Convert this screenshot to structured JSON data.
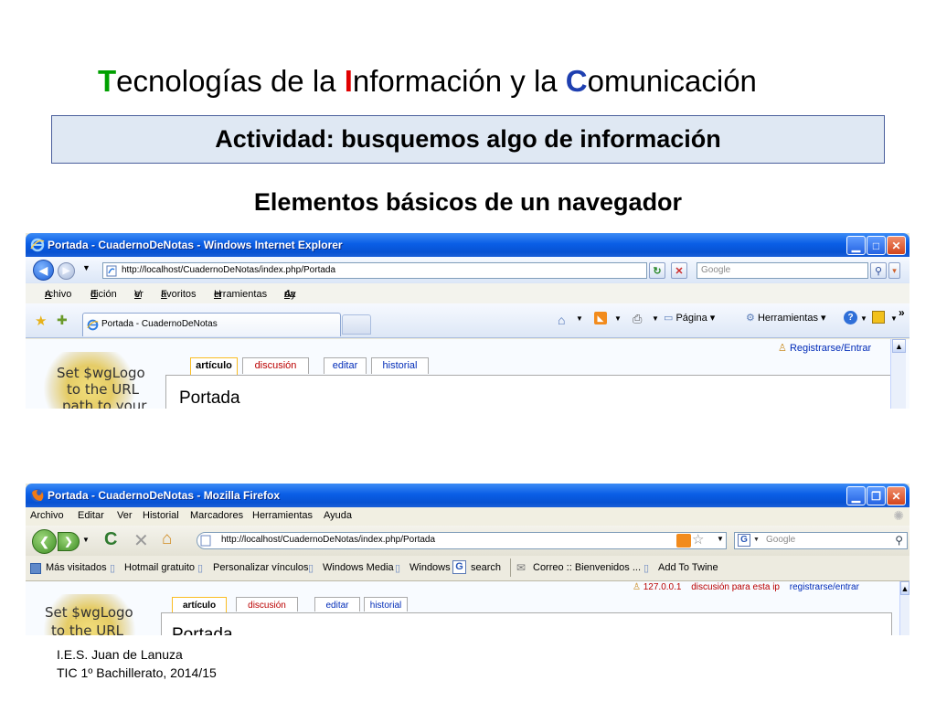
{
  "slide": {
    "title_parts": {
      "t_cap": "T",
      "t_rest": "ecnologías de la ",
      "i_cap": "I",
      "i_rest": "nformación y la ",
      "c_cap": "C",
      "c_rest": "omunicación"
    },
    "activity": "Actividad: busquemos algo de información",
    "subtitle": "Elementos básicos de un navegador",
    "colors": {
      "t_cap": "#00a000",
      "i_cap": "#e00000",
      "c_cap": "#1e3fb0",
      "box_bg": "#dfe8f3",
      "box_border": "#4a5f9c"
    }
  },
  "ie": {
    "window_title": "Portada - CuadernoDeNotas - Windows Internet Explorer",
    "address": "http://localhost/CuadernoDeNotas/index.php/Portada",
    "search_placeholder": "Google",
    "menu": [
      "Archivo",
      "Edición",
      "Ver",
      "Favoritos",
      "Herramientas",
      "Ayuda"
    ],
    "menu_access_keys": [
      "A",
      "E",
      "V",
      "F",
      "H",
      "u"
    ],
    "tab_label": "Portada - CuadernoDeNotas",
    "command_bar": {
      "page": "Página",
      "tools": "Herramientas"
    },
    "chevron": "»",
    "login": "Registrarse/Entrar",
    "logo_text": [
      "Set $wgLogo",
      "to the URL",
      "path to your"
    ],
    "page_tabs": [
      "artículo",
      "discusión",
      "editar",
      "historial"
    ],
    "page_title": "Portada"
  },
  "ff": {
    "window_title": "Portada - CuadernoDeNotas - Mozilla Firefox",
    "menu": [
      "Archivo",
      "Editar",
      "Ver",
      "Historial",
      "Marcadores",
      "Herramientas",
      "Ayuda"
    ],
    "address": "http://localhost/CuadernoDeNotas/index.php/Portada",
    "search_placeholder": "Google",
    "bookmarks": [
      "Más visitados",
      "Hotmail gratuito",
      "Personalizar vínculos",
      "Windows Media",
      "Windows",
      "search",
      "Correo :: Bienvenidos ...",
      "Add To Twine"
    ],
    "personal_links": [
      "127.0.0.1",
      "discusión para esta ip",
      "registrarse/entrar"
    ],
    "logo_text": [
      "Set $wgLogo",
      "to the URL"
    ],
    "page_tabs": [
      "artículo",
      "discusión",
      "editar",
      "historial"
    ],
    "page_title": "Portada"
  },
  "footer": {
    "line1": "I.E.S. Juan de Lanuza",
    "line2": "TIC 1º Bachillerato, 2014/15"
  },
  "icons": [
    "ie-logo-icon",
    "firefox-logo-icon",
    "back-icon",
    "forward-icon",
    "refresh-icon",
    "stop-icon",
    "home-icon",
    "rss-icon",
    "print-icon",
    "star-icon",
    "search-icon",
    "help-icon",
    "page-icon",
    "minimize-icon",
    "maximize-icon",
    "restore-icon",
    "close-icon",
    "user-icon"
  ]
}
